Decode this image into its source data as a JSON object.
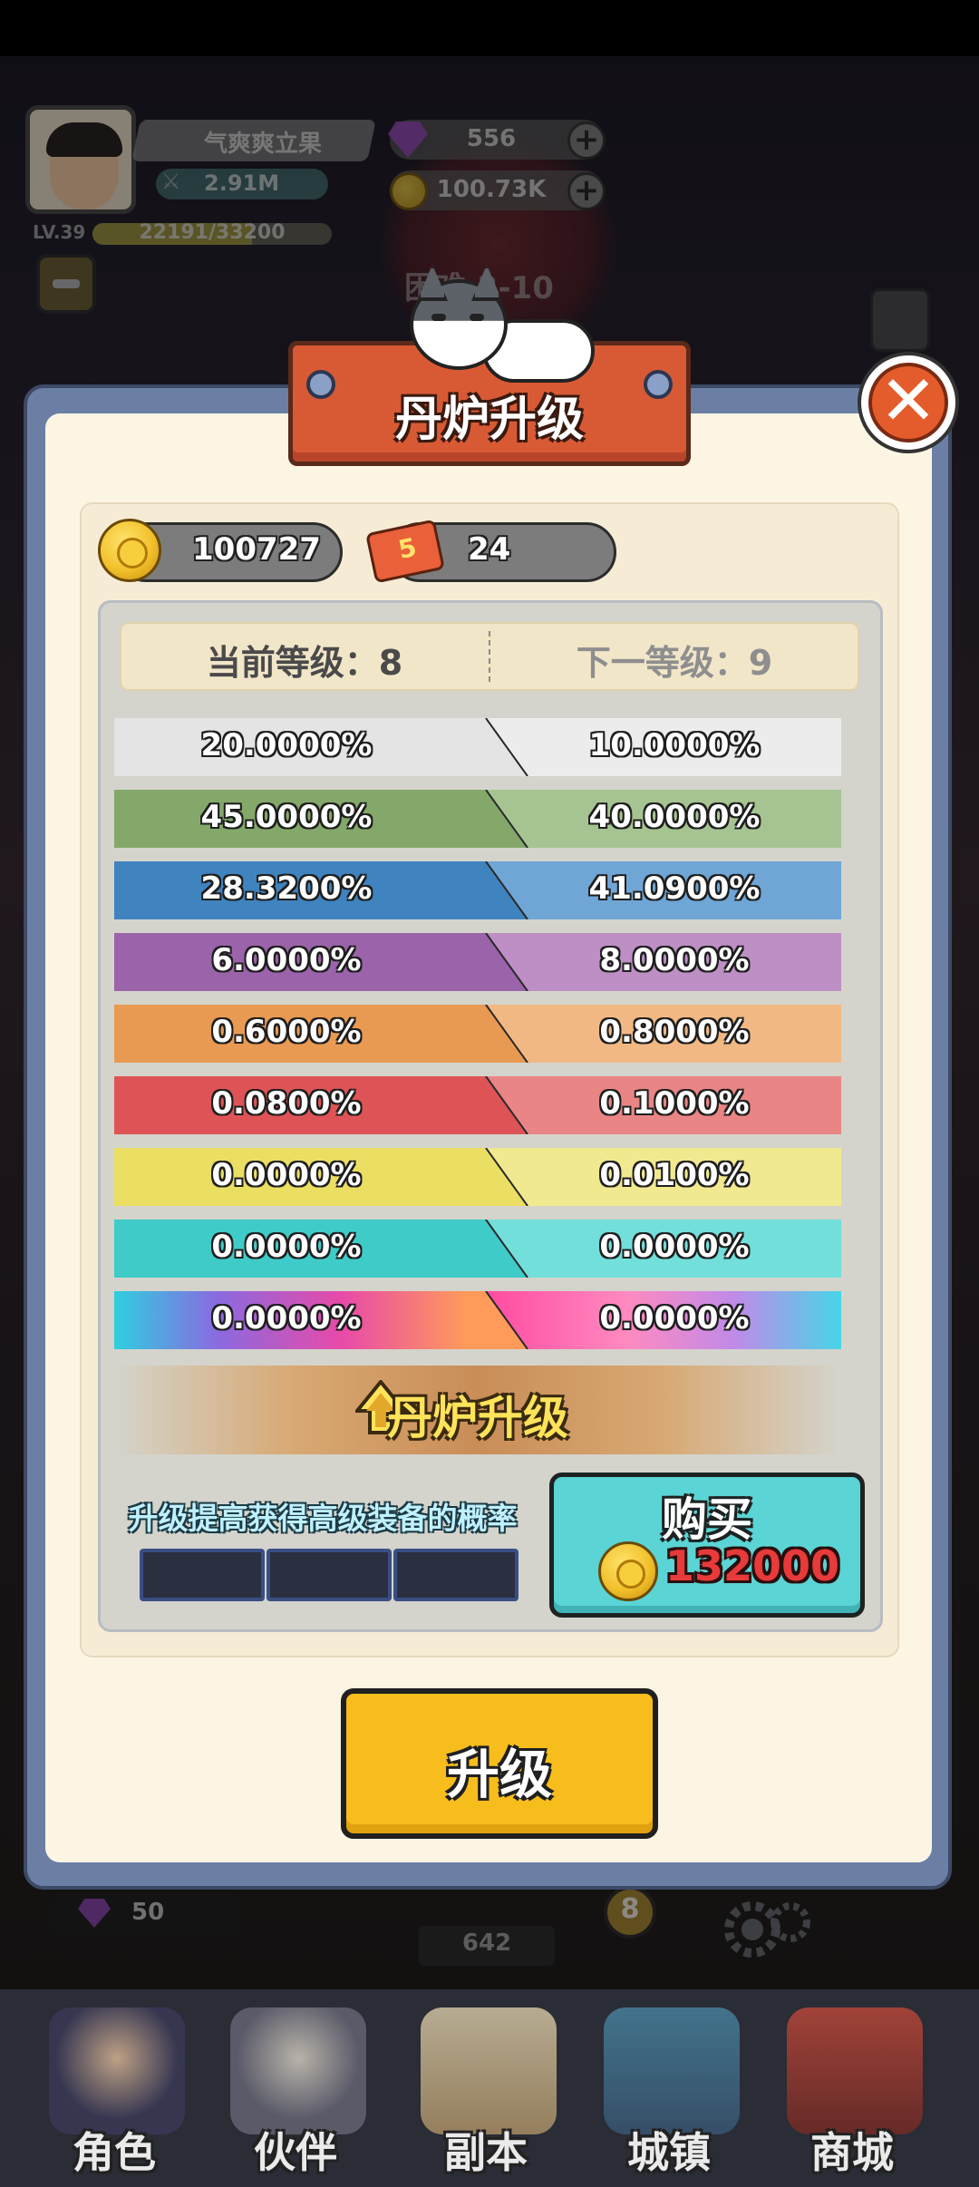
{
  "hud": {
    "player_name": "气爽爽立果",
    "power": "2.91M",
    "level": "LV.39",
    "exp": "22191/33200",
    "exp_fraction": 0.668,
    "gems": "556",
    "coins": "100.73K",
    "stage": "困难 3-10"
  },
  "modal": {
    "title": "丹炉升级",
    "coin_balance": "100727",
    "ticket_count": "24",
    "ticket_badge": "5",
    "current_level_label": "当前等级：8",
    "next_level_label": "下一等级：9",
    "rates": [
      {
        "current": "20.0000%",
        "next": "10.0000%",
        "color_left": "#e4e4e4",
        "color_right": "#ececec"
      },
      {
        "current": "45.0000%",
        "next": "40.0000%",
        "color_left": "#84a86a",
        "color_right": "#a6c491"
      },
      {
        "current": "28.3200%",
        "next": "41.0900%",
        "color_left": "#3f83bf",
        "color_right": "#6fa6d6"
      },
      {
        "current": "6.0000%",
        "next": "8.0000%",
        "color_left": "#9b63a9",
        "color_right": "#bd8fc5"
      },
      {
        "current": "0.6000%",
        "next": "0.8000%",
        "color_left": "#e99a52",
        "color_right": "#f2b884"
      },
      {
        "current": "0.0800%",
        "next": "0.1000%",
        "color_left": "#de5456",
        "color_right": "#ea8585"
      },
      {
        "current": "0.0000%",
        "next": "0.0100%",
        "color_left": "#ebdf63",
        "color_right": "#f1e98f"
      },
      {
        "current": "0.0000%",
        "next": "0.0000%",
        "color_left": "#3fcbc8",
        "color_right": "#72dfdb"
      },
      {
        "current": "0.0000%",
        "next": "0.0000%",
        "color_left": "rainbow",
        "color_right": "rainbow"
      }
    ],
    "upgrade_strip_label": "丹炉升级",
    "hint": "升级提高获得高级装备的概率",
    "progress_filled": 0,
    "progress_total": 3,
    "buy_label": "购买",
    "buy_price": "132000",
    "upgrade_button": "升级",
    "close_icon": "close-icon"
  },
  "background": {
    "gem_chip": "50",
    "counter": "642",
    "badge": "8"
  },
  "nav": [
    {
      "label": "角色",
      "icon": "character-icon"
    },
    {
      "label": "伙伴",
      "icon": "partner-icon"
    },
    {
      "label": "副本",
      "icon": "dungeon-icon"
    },
    {
      "label": "城镇",
      "icon": "town-icon"
    },
    {
      "label": "商城",
      "icon": "shop-icon"
    }
  ]
}
